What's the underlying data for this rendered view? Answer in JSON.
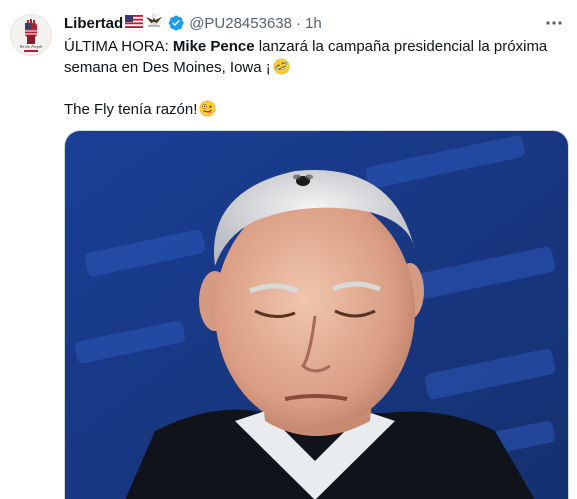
{
  "tweet": {
    "display_name": "Libertad",
    "handle": "@PU28453638",
    "separator": "·",
    "time": "1h",
    "line1_prefix": "ÚLTIMA HORA: ",
    "line1_bold": "Mike Pence",
    "line1_rest": " lanzará la campaña presidencial la próxima",
    "line2": "semana en Des Moines, Iowa ¡",
    "line3": "The Fly tenía razón!"
  },
  "avatar": {
    "caption": "We the People"
  },
  "icons": {
    "verified": "verified-badge-icon",
    "more": "more-options-icon",
    "flag": "us-flag-emoji",
    "eagle": "eagle-emoji",
    "laugh": "rolling-laughing-emoji",
    "zany": "zany-face-emoji"
  },
  "colors": {
    "verified_blue": "#1d9bf0",
    "text_primary": "#0f1419",
    "text_secondary": "#536471",
    "media_backdrop": "#1c3d8f"
  }
}
